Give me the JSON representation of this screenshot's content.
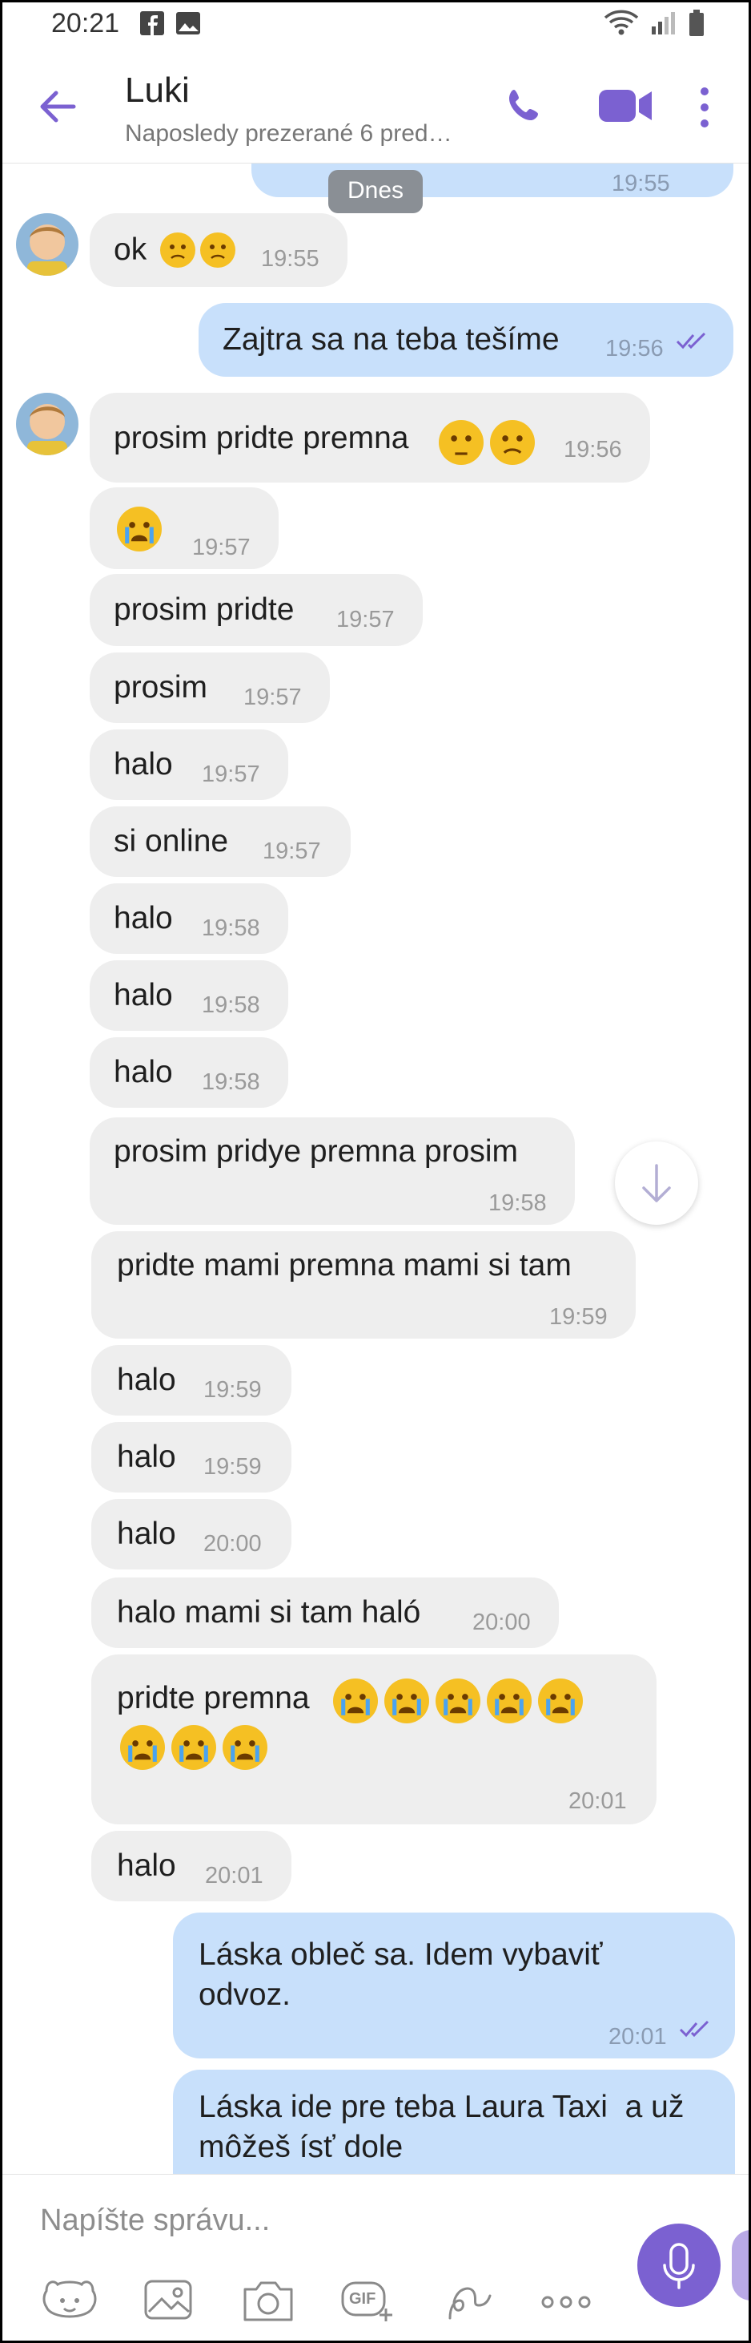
{
  "status_bar": {
    "time": "20:21",
    "left_icons": [
      "facebook-icon",
      "gallery-icon"
    ],
    "right_icons": [
      "wifi-icon",
      "signal-icon",
      "battery-icon"
    ]
  },
  "header": {
    "contact_name": "Luki",
    "subtitle": "Naposledy prezerané 6 pred…",
    "accent_color": "#7b61d1"
  },
  "chat": {
    "day_label": "Dnes",
    "partial_top_time": "19:55",
    "messages": [
      {
        "dir": "in",
        "avatar": true,
        "text": "ok",
        "emoji": [
          "worried",
          "worried"
        ],
        "time": "19:55"
      },
      {
        "dir": "out",
        "text": "Zajtra sa na teba tešíme",
        "time": "19:56",
        "read": true
      },
      {
        "dir": "in",
        "avatar": true,
        "text": "prosim pridte premna",
        "emoji": [
          "rolling-eyes",
          "frown"
        ],
        "time": "19:56"
      },
      {
        "dir": "in",
        "text": "",
        "emoji": [
          "crying"
        ],
        "time": "19:57"
      },
      {
        "dir": "in",
        "text": "prosim pridte",
        "time": "19:57"
      },
      {
        "dir": "in",
        "text": "prosim",
        "time": "19:57"
      },
      {
        "dir": "in",
        "text": "halo",
        "time": "19:57"
      },
      {
        "dir": "in",
        "text": "si online",
        "time": "19:57"
      },
      {
        "dir": "in",
        "text": "halo",
        "time": "19:58"
      },
      {
        "dir": "in",
        "text": "halo",
        "time": "19:58"
      },
      {
        "dir": "in",
        "text": "halo",
        "time": "19:58"
      },
      {
        "dir": "in",
        "text": "prosim pridye premna prosim",
        "time": "19:58"
      },
      {
        "dir": "in",
        "text": "pridte mami premna mami si tam",
        "time": "19:59"
      },
      {
        "dir": "in",
        "text": "halo",
        "time": "19:59"
      },
      {
        "dir": "in",
        "text": "halo",
        "time": "19:59"
      },
      {
        "dir": "in",
        "text": "halo",
        "time": "20:00"
      },
      {
        "dir": "in",
        "text": "halo mami si tam haló",
        "time": "20:00"
      },
      {
        "dir": "in",
        "text": "pridte premna",
        "emoji": [
          "crying",
          "crying",
          "crying",
          "crying",
          "crying",
          "crying",
          "crying",
          "crying"
        ],
        "time": "20:01"
      },
      {
        "dir": "in",
        "text": "halo",
        "time": "20:01"
      },
      {
        "dir": "out",
        "text": "Láska obleč sa. Idem vybaviť\nodvoz.",
        "time": "20:01",
        "read": true
      },
      {
        "dir": "out",
        "text": "Láska ide pre teba Laura Taxi  a už\nmôžeš ísť dole",
        "time": ""
      }
    ]
  },
  "compose": {
    "placeholder": "Napíšte správu...",
    "tools": [
      "sticker-icon",
      "gallery-icon",
      "camera-icon",
      "gif-icon",
      "doodle-icon",
      "more-icon"
    ],
    "gif_label": "GIF"
  },
  "colors": {
    "incoming": "#eeeeee",
    "outgoing": "#c8e0fb",
    "accent": "#7b61d1"
  }
}
